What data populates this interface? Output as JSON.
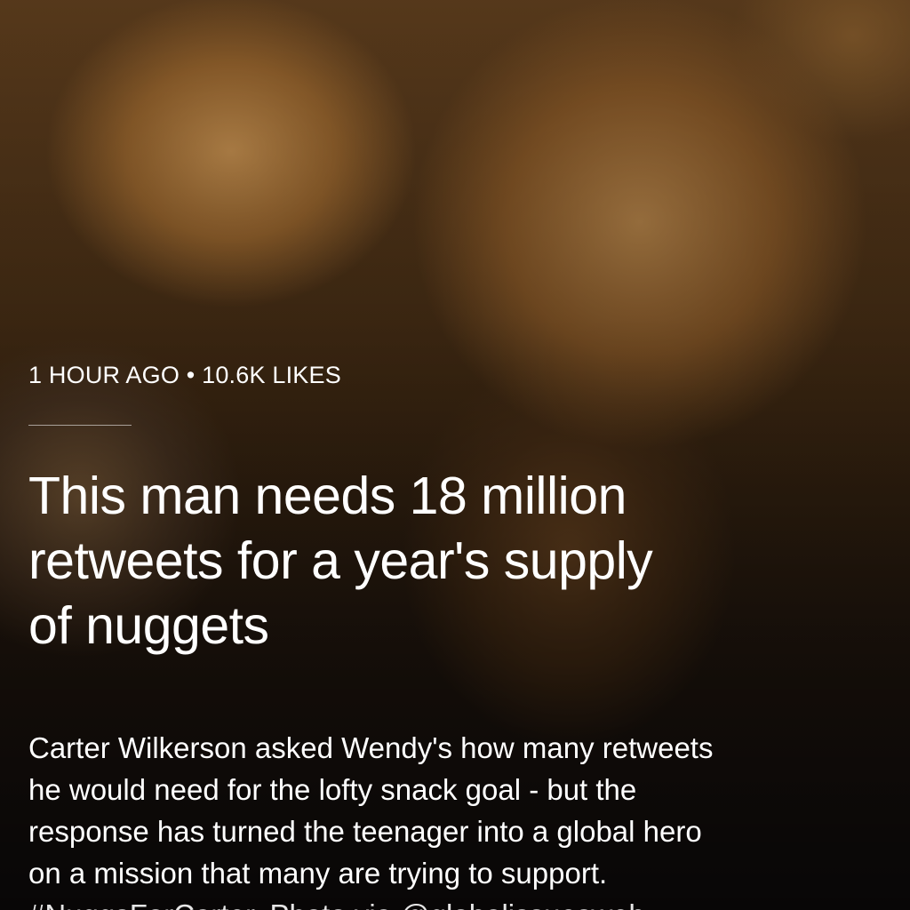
{
  "post": {
    "time_ago": "1 HOUR AGO",
    "separator": "•",
    "likes": "10.6K LIKES",
    "headline_lines": [
      "This man needs 18 million",
      "retweets for a year's supply",
      "of nuggets"
    ],
    "body_lines": [
      "Carter Wilkerson asked Wendy's how many retweets",
      "he would need for the lofty snack goal - but the",
      "response has turned the teenager into a global hero",
      "on a mission that many are trying to support."
    ],
    "body_cut_line": "#NuggsForCarter. Photo via @globalissuesweb"
  },
  "background": {
    "image_subject": "fried chicken nuggets photo",
    "dominant_color": "#7d5124"
  }
}
